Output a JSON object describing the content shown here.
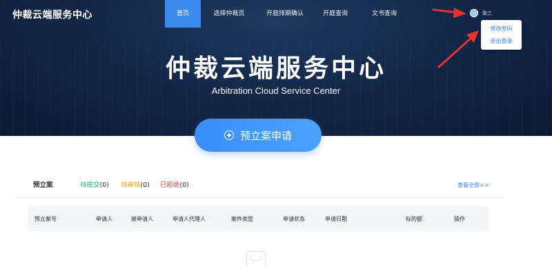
{
  "header": {
    "logo": "仲裁云端服务中心",
    "nav": [
      "首页",
      "选择仲裁员",
      "开庭排期确认",
      "开庭查询",
      "文书查询"
    ],
    "user": {
      "name": "张三",
      "menu": [
        "修改密码",
        "退出登录"
      ]
    }
  },
  "hero": {
    "title": "仲裁云端服务中心",
    "subtitle": "Arbitration Cloud Service Center",
    "apply_button": "预立案申请"
  },
  "cases": {
    "title": "预立案",
    "tabs": [
      {
        "label": "待提交",
        "count": "(0)"
      },
      {
        "label": "待审核",
        "count": "(0)"
      },
      {
        "label": "已拒绝",
        "count": "(0)"
      }
    ],
    "view_all": "查看全部>>",
    "columns": [
      "预立案号",
      "申请人",
      "被申请人",
      "申请人代理人",
      "案件类型",
      "申请状态",
      "申请日期",
      "标的额",
      "操作"
    ]
  },
  "colors": {
    "accent": "#3c8cf0",
    "pending_submit": "#35b37e",
    "pending_review": "#f39c12",
    "rejected": "#e84a4a",
    "annotation_arrow": "#e8312f"
  }
}
